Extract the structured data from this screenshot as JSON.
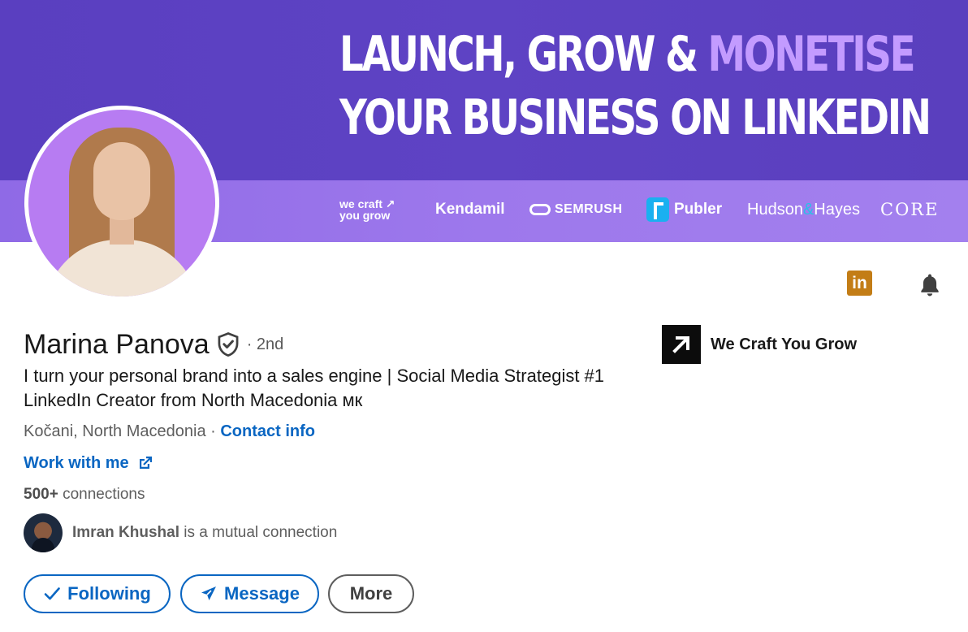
{
  "banner": {
    "headline_line1_a": "LAUNCH, GROW & ",
    "headline_line1_b": "MONETISE",
    "headline_line2": "YOUR BUSINESS ON LINKEDIN",
    "logos": {
      "wecraft_1": "we craft ↗",
      "wecraft_2": "you grow",
      "kendamil": "Kendamil",
      "semrush": "SEMRUSH",
      "publer": "Publer",
      "hudson_a": "Hudson",
      "hudson_amp": "&",
      "hudson_b": "Hayes",
      "core": "CORE"
    },
    "colors": {
      "top": "#5c41c2",
      "strip": "#9a75ea",
      "accent": "#c39bff"
    }
  },
  "profile": {
    "name": "Marina Panova",
    "degree": "· 2nd",
    "headline": "I turn your personal brand into a sales engine | Social Media Strategist #1 LinkedIn Creator from North Macedonia мк",
    "location": "Kočani, North Macedonia ·",
    "contact_info": "Contact info",
    "website": "Work with me",
    "connections_count": "500+",
    "connections_label": "connections",
    "mutual_name": "Imran Khushal",
    "mutual_suffix": "is a mutual connection"
  },
  "company": {
    "name": "We Craft You Grow"
  },
  "icons": {
    "linkedin": "in",
    "linkedin_icon": "linkedin-icon",
    "bell_icon": "bell-icon",
    "verified_icon": "shield-check-icon",
    "external_icon": "external-link-icon"
  },
  "actions": {
    "following": "Following",
    "message": "Message",
    "more": "More"
  },
  "theme": {
    "link": "#0a66c2",
    "text": "#191919",
    "muted": "#5e5e5e"
  }
}
